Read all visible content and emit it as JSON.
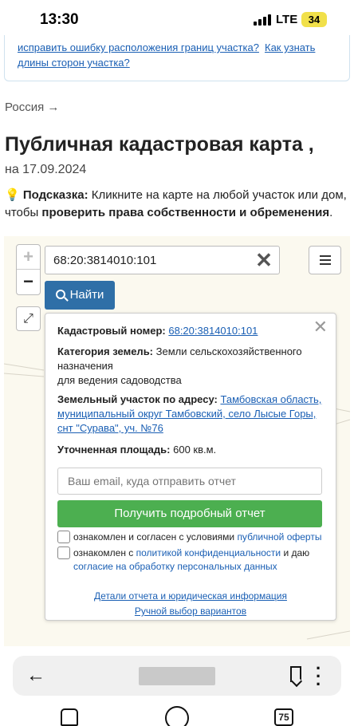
{
  "status_bar": {
    "time": "13:30",
    "network": "LTE",
    "battery": "34"
  },
  "info_box": {
    "link_1": "исправить ошибку расположения границ участка?",
    "link_2": "Как узнать",
    "link_3": "длины сторон участка?"
  },
  "breadcrumb": "Россия →",
  "page": {
    "title": "Публичная кадастровая карта ,",
    "date": "на 17.09.2024"
  },
  "hint": {
    "label": "Подсказка:",
    "text_1": " Кликните на карте на любой участок или дом, чтобы ",
    "bold": "проверить права собственности и обременения",
    "text_2": "."
  },
  "map": {
    "search_value": "68:20:3814010:101",
    "find_label": "Найти",
    "zoom_in": "+",
    "zoom_out": "−"
  },
  "popup": {
    "cad_label": "Кадастровый номер:",
    "cad_value": "68:20:3814010:101",
    "category_label": "Категория земель:",
    "category_value": "Земли сельскохозяйственного назначения",
    "category_value_2": "для ведения садоводства",
    "address_label": "Земельный участок по адресу:",
    "address_value": "Тамбовская область, муниципальный округ Тамбовский, село Лысые Горы, снт \"Сурава\", уч. №76",
    "area_label": "Уточненная площадь:",
    "area_value": "600 кв.м.",
    "email_placeholder": "Ваш email, куда отправить отчет",
    "report_button": "Получить подробный отчет",
    "check_1_text": "ознакомлен и согласен с условиями ",
    "check_1_link": "публичной оферты",
    "check_2_text": "ознакомлен с ",
    "check_2_link": "политикой конфиденциальности",
    "check_2_text_b": " и даю ",
    "check_2_link_b": "согласие на обработку персональных данных",
    "details_link": "Детали отчета и юридическая информация",
    "manual_link": "Ручной выбор вариантов"
  },
  "browser": {
    "tabs_count": "75"
  },
  "colors": {
    "link": "#1a5fb4",
    "find_button": "#2f6fa7",
    "report_button": "#4caf50",
    "battery": "#f1e04a"
  }
}
